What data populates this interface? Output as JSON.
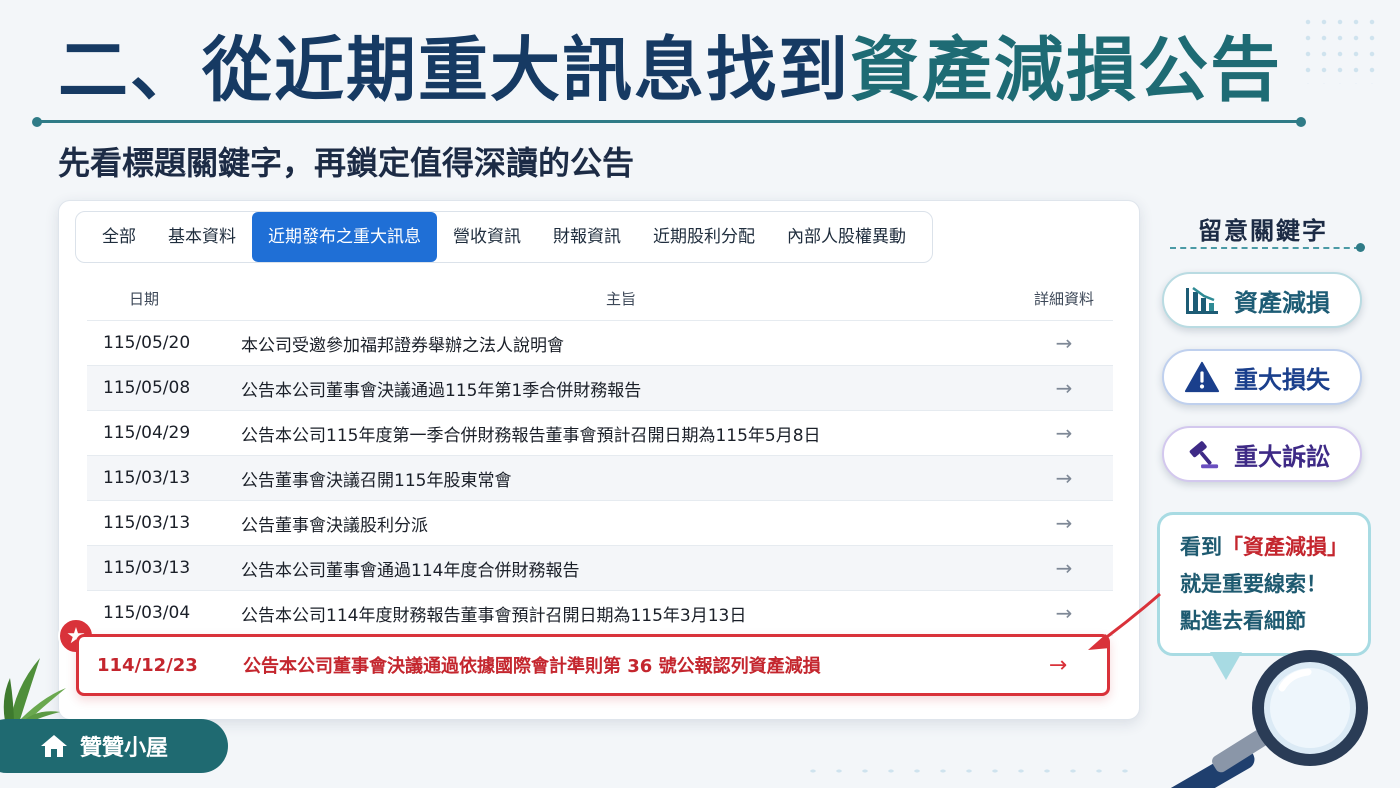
{
  "title": {
    "part1": "二、從近期重大訊息找到",
    "part2": "資產減損公告"
  },
  "subtitle": "先看標題關鍵字，再鎖定值得深讀的公告",
  "tabs": [
    {
      "label": "全部",
      "active": false
    },
    {
      "label": "基本資料",
      "active": false
    },
    {
      "label": "近期發布之重大訊息",
      "active": true
    },
    {
      "label": "營收資訊",
      "active": false
    },
    {
      "label": "財報資訊",
      "active": false
    },
    {
      "label": "近期股利分配",
      "active": false
    },
    {
      "label": "內部人股權異動",
      "active": false
    }
  ],
  "table": {
    "headers": {
      "date": "日期",
      "subject": "主旨",
      "detail": "詳細資料"
    },
    "rows": [
      {
        "date": "115/05/20",
        "subject": "本公司受邀參加福邦證券舉辦之法人說明會"
      },
      {
        "date": "115/05/08",
        "subject": "公告本公司董事會決議通過115年第1季合併財務報告"
      },
      {
        "date": "115/04/29",
        "subject": "公告本公司115年度第一季合併財務報告董事會預計召開日期為115年5月8日"
      },
      {
        "date": "115/03/13",
        "subject": "公告董事會決議召開115年股東常會"
      },
      {
        "date": "115/03/13",
        "subject": "公告董事會決議股利分派"
      },
      {
        "date": "115/03/13",
        "subject": "公告本公司董事會通過114年度合併財務報告"
      },
      {
        "date": "115/03/04",
        "subject": "公告本公司114年度財務報告董事會預計召開日期為115年3月13日"
      }
    ],
    "highlight": {
      "date": "114/12/23",
      "subject": "公告本公司董事會決議通過依據國際會計準則第 36 號公報認列資產減損"
    },
    "arrow_glyph": "→"
  },
  "keywords": {
    "title": "留意關鍵字",
    "items": [
      {
        "label": "資產減損",
        "icon": "bar-chart-down-icon",
        "color": "#1d5c75"
      },
      {
        "label": "重大損失",
        "icon": "warning-icon",
        "color": "#1a3f8c"
      },
      {
        "label": "重大訴訟",
        "icon": "gavel-icon",
        "color": "#3e2a86"
      }
    ]
  },
  "callout": {
    "line1_prefix": "看到",
    "line1_highlight": "「資產減損」",
    "line2": "就是重要線索！",
    "line3": "點進去看細節"
  },
  "brand": {
    "label": "贊贊小屋",
    "icon": "home-icon"
  },
  "colors": {
    "accent": "#1f6fd6",
    "teal": "#1e6b74",
    "navy": "#163a63",
    "alert": "#d9323a"
  }
}
